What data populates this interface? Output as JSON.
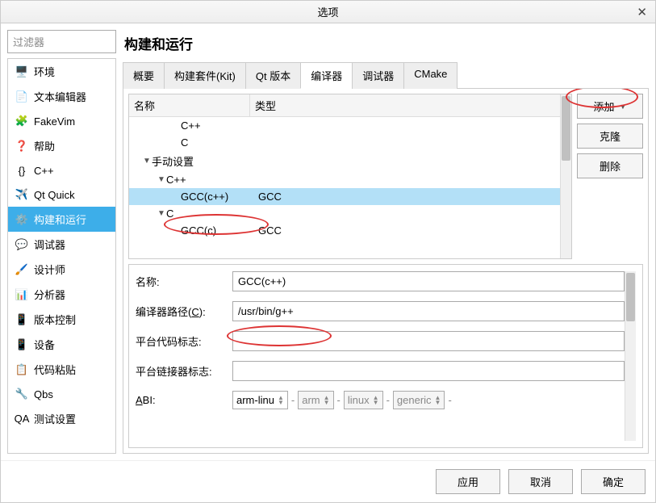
{
  "window": {
    "title": "选项"
  },
  "filter_placeholder": "过滤器",
  "categories": [
    {
      "label": "环境"
    },
    {
      "label": "文本编辑器"
    },
    {
      "label": "FakeVim"
    },
    {
      "label": "帮助"
    },
    {
      "label": "C++"
    },
    {
      "label": "Qt Quick"
    },
    {
      "label": "构建和运行"
    },
    {
      "label": "调试器"
    },
    {
      "label": "设计师"
    },
    {
      "label": "分析器"
    },
    {
      "label": "版本控制"
    },
    {
      "label": "设备"
    },
    {
      "label": "代码粘贴"
    },
    {
      "label": "Qbs"
    },
    {
      "label": "测试设置"
    }
  ],
  "page_title": "构建和运行",
  "tabs": [
    "概要",
    "构建套件(Kit)",
    "Qt 版本",
    "编译器",
    "调试器",
    "CMake"
  ],
  "tree": {
    "header": {
      "name": "名称",
      "type": "类型"
    },
    "rows": [
      {
        "indent": 2,
        "toggle": "",
        "name": "C++",
        "type": ""
      },
      {
        "indent": 2,
        "toggle": "",
        "name": "C",
        "type": ""
      },
      {
        "indent": 0,
        "toggle": "▼",
        "name": "手动设置",
        "type": ""
      },
      {
        "indent": 1,
        "toggle": "▼",
        "name": "C++",
        "type": ""
      },
      {
        "indent": 2,
        "toggle": "",
        "name": "GCC(c++)",
        "type": "GCC",
        "selected": true
      },
      {
        "indent": 1,
        "toggle": "▼",
        "name": "C",
        "type": ""
      },
      {
        "indent": 2,
        "toggle": "",
        "name": "GCC(c)",
        "type": "GCC"
      }
    ]
  },
  "side_buttons": {
    "add": "添加",
    "clone": "克隆",
    "remove": "删除"
  },
  "form": {
    "name_label": "名称:",
    "name_value": "GCC(c++)",
    "path_label": "编译器路径(C):",
    "path_value": "/usr/bin/g++",
    "platform_code_label": "平台代码标志:",
    "platform_code_value": "",
    "platform_link_label": "平台链接器标志:",
    "platform_link_value": "",
    "abi_label": "ABI:",
    "abi": [
      "arm-linu",
      "arm",
      "linux",
      "generic"
    ]
  },
  "dialog_buttons": {
    "apply": "应用",
    "cancel": "取消",
    "ok": "确定"
  }
}
